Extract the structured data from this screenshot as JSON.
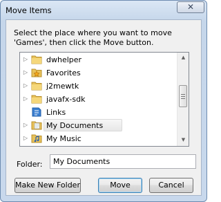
{
  "window": {
    "title": "Move Items",
    "close_glyph": "✕"
  },
  "instructions": "Select the place where you want to move 'Games', then click the Move button.",
  "tree": {
    "items": [
      {
        "label": "dwhelper",
        "icon": "folder-icon",
        "expandable": true,
        "selected": false
      },
      {
        "label": "Favorites",
        "icon": "favorites-folder-icon",
        "expandable": true,
        "selected": false
      },
      {
        "label": "j2mewtk",
        "icon": "folder-icon",
        "expandable": true,
        "selected": false
      },
      {
        "label": "javafx-sdk",
        "icon": "folder-icon",
        "expandable": true,
        "selected": false
      },
      {
        "label": "Links",
        "icon": "links-folder-icon",
        "expandable": false,
        "selected": false
      },
      {
        "label": "My Documents",
        "icon": "documents-folder-icon",
        "expandable": true,
        "selected": true
      },
      {
        "label": "My Music",
        "icon": "music-folder-icon",
        "expandable": true,
        "selected": false
      }
    ]
  },
  "folder": {
    "label": "Folder:",
    "value": "My Documents"
  },
  "buttons": {
    "new_folder": "Make New Folder",
    "move": "Move",
    "cancel": "Cancel"
  },
  "colors": {
    "dialog_frame": "#c8d8ec",
    "default_button_border": "#3c7fb1",
    "folder_yellow": "#e8c25a"
  }
}
